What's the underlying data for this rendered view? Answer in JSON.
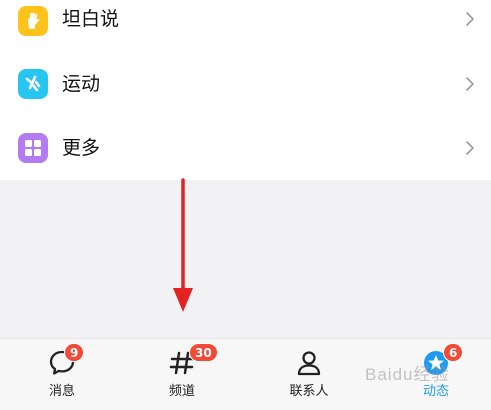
{
  "menu": {
    "items": [
      {
        "label": "坦白说",
        "icon": "hand-icon",
        "color": "#ffc21a"
      },
      {
        "label": "运动",
        "icon": "runner-icon",
        "color": "#27c6f0"
      },
      {
        "label": "更多",
        "icon": "grid-icon",
        "color": "#b27cf0"
      }
    ]
  },
  "tabbar": {
    "tabs": [
      {
        "label": "消息",
        "icon": "chat-bubble-icon",
        "badge": "9"
      },
      {
        "label": "频道",
        "icon": "hash-icon",
        "badge": "30"
      },
      {
        "label": "联系人",
        "icon": "person-icon",
        "badge": ""
      },
      {
        "label": "动态",
        "icon": "star-icon",
        "badge": "6",
        "active": true
      }
    ]
  },
  "colors": {
    "active_tab": "#1e9bf0",
    "badge": "#f24a36",
    "arrow": "#e52222"
  },
  "watermark": "Baidu经验"
}
